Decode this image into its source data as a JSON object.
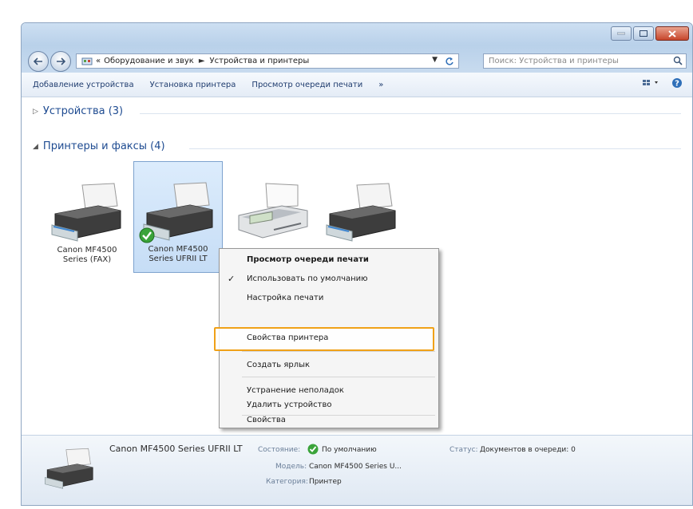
{
  "address": {
    "crumbs": [
      "Оборудование и звук",
      "Устройства и принтеры"
    ],
    "prefix": "«",
    "separator": "►"
  },
  "search": {
    "placeholder": "Поиск: Устройства и принтеры"
  },
  "toolbar": {
    "items": [
      "Добавление устройства",
      "Установка принтера",
      "Просмотр очереди печати"
    ],
    "more": "»"
  },
  "groups": {
    "devices": "Устройства (3)",
    "printers": "Принтеры и факсы (4)"
  },
  "printers": [
    {
      "line1": "Canon MF4500",
      "line2": "Series (FAX)"
    },
    {
      "line1": "Canon MF4500",
      "line2": "Series UFRII LT"
    },
    {
      "line1": "",
      "line2": ""
    },
    {
      "line1": "",
      "line2": ""
    }
  ],
  "context_menu": {
    "items": [
      "Просмотр очереди печати",
      "Использовать по умолчанию",
      "Настройка печати",
      "Свойства принтера",
      "Создать ярлык",
      "Устранение неполадок",
      "Удалить устройство",
      "Свойства"
    ],
    "check": "✓"
  },
  "details": {
    "name": "Canon MF4500 Series UFRII LT",
    "state_label": "Состояние:",
    "state_value": "По умолчанию",
    "status_label": "Статус:",
    "status_value": "Документов в очереди: 0",
    "model_label": "Модель:",
    "model_value": "Canon MF4500 Series U...",
    "category_label": "Категория:",
    "category_value": "Принтер"
  },
  "colors": {
    "accent_highlight": "#f0a118",
    "link_blue": "#1e4b91"
  }
}
